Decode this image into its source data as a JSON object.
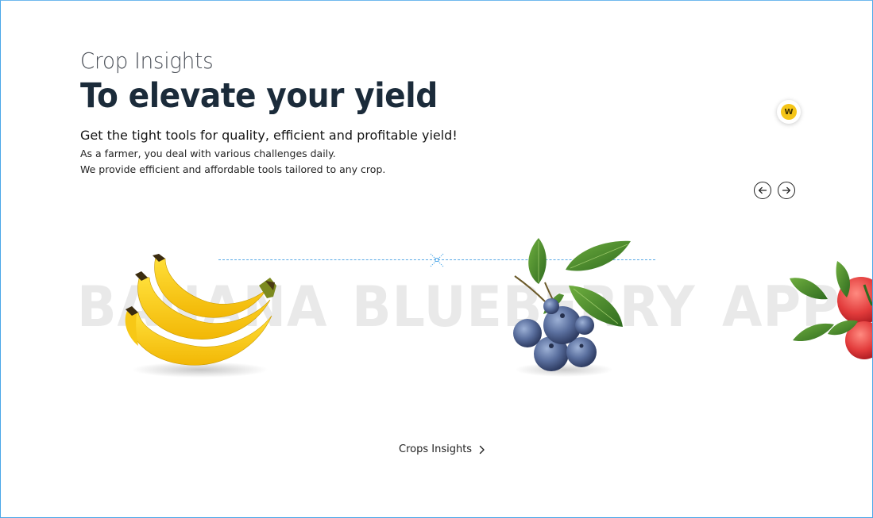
{
  "hero": {
    "eyebrow": "Crop Insights",
    "headline": "To elevate your yield",
    "subhead": "Get the tight tools for quality, efficient and profitable yield!",
    "desc_line1": "As a farmer, you deal with various challenges daily.",
    "desc_line2": "We provide efficient and affordable tools tailored to any crop."
  },
  "avatar": {
    "initial": "W",
    "color": "#f5c518"
  },
  "carousel": {
    "prev_icon": "arrow-left-circle-icon",
    "next_icon": "arrow-right-circle-icon",
    "items": [
      {
        "label": "BANANA"
      },
      {
        "label": "BLUEBERRY"
      },
      {
        "label": "APP"
      }
    ]
  },
  "cta": {
    "label": "Crops Insights",
    "icon": "chevron-right-icon"
  },
  "colors": {
    "headline": "#1b2b3a",
    "watermark": "#e9e9e9",
    "frame": "#4aa6e8"
  }
}
